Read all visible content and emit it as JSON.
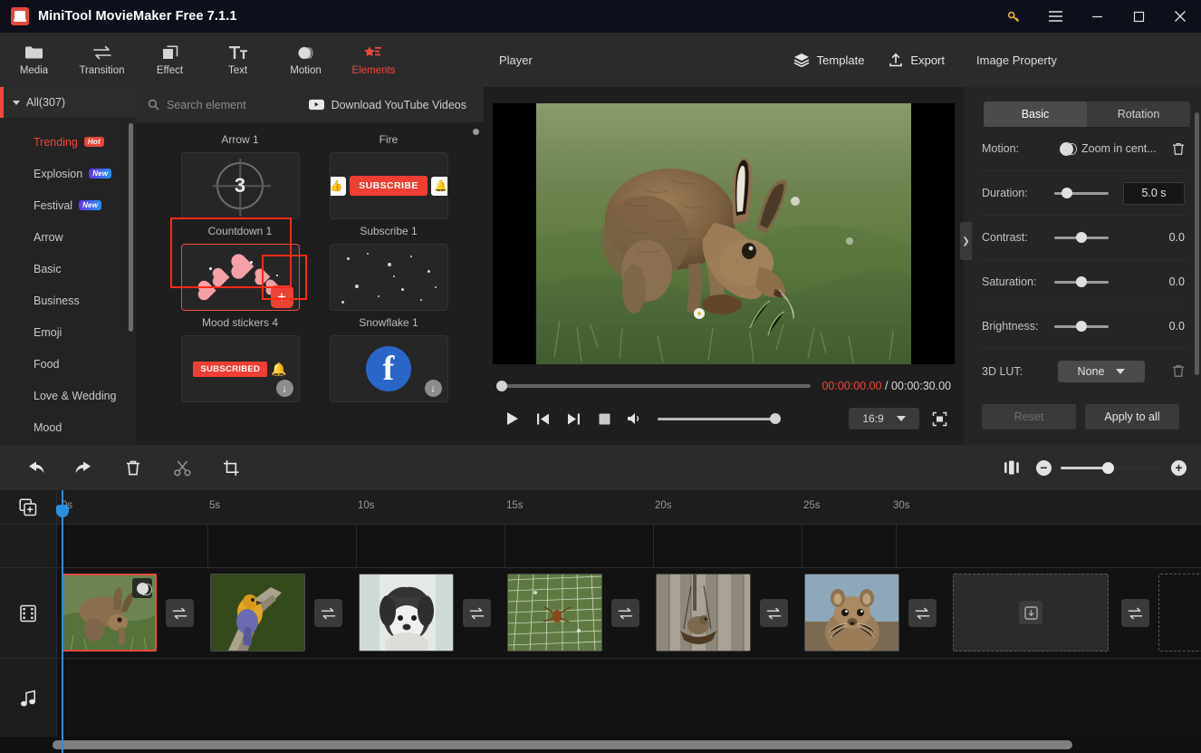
{
  "titlebar": {
    "app_name": "MiniTool MovieMaker Free 7.1.1",
    "logo_icon": "app-logo-icon",
    "key_icon": "key-icon",
    "menu_icon": "hamburger-menu-icon",
    "minimize_icon": "minimize-icon",
    "maximize_icon": "maximize-icon",
    "close_icon": "close-icon"
  },
  "toolbar": {
    "items": [
      {
        "label": "Media",
        "icon": "folder-icon",
        "active": false
      },
      {
        "label": "Transition",
        "icon": "transition-arrows-icon",
        "active": false
      },
      {
        "label": "Effect",
        "icon": "layers-square-icon",
        "active": false
      },
      {
        "label": "Text",
        "icon": "text-tt-icon",
        "active": false
      },
      {
        "label": "Motion",
        "icon": "motion-circle-icon",
        "active": false
      },
      {
        "label": "Elements",
        "icon": "elements-star-icon",
        "active": true
      }
    ],
    "active_color": "#f0483c"
  },
  "categories": {
    "all_label": "All(307)",
    "items": [
      {
        "label": "Trending",
        "badge": "Hot",
        "badge_type": "hot",
        "highlighted": true
      },
      {
        "label": "Explosion",
        "badge": "New",
        "badge_type": "new",
        "highlighted": false
      },
      {
        "label": "Festival",
        "badge": "New",
        "badge_type": "new",
        "highlighted": false
      },
      {
        "label": "Arrow",
        "badge": "",
        "badge_type": "",
        "highlighted": false
      },
      {
        "label": "Basic",
        "badge": "",
        "badge_type": "",
        "highlighted": false
      },
      {
        "label": "Business",
        "badge": "",
        "badge_type": "",
        "highlighted": false
      },
      {
        "label": "Emoji",
        "badge": "",
        "badge_type": "",
        "highlighted": false
      },
      {
        "label": "Food",
        "badge": "",
        "badge_type": "",
        "highlighted": false
      },
      {
        "label": "Love & Wedding",
        "badge": "",
        "badge_type": "",
        "highlighted": false
      },
      {
        "label": "Mood",
        "badge": "",
        "badge_type": "",
        "highlighted": false
      }
    ]
  },
  "elements_panel": {
    "search_placeholder": "Search element",
    "search_value": "",
    "search_icon": "search-icon",
    "download_label": "Download YouTube Videos",
    "download_icon": "youtube-download-icon",
    "row0": [
      {
        "caption": "Arrow 1"
      },
      {
        "caption": "Fire"
      }
    ],
    "row1": [
      {
        "caption": "Countdown 1",
        "number": "3"
      },
      {
        "caption": "Subscribe 1",
        "button_text": "SUBSCRIBE"
      }
    ],
    "row2": [
      {
        "caption": "Mood stickers 4",
        "selected": true,
        "add_icon": "plus-icon"
      },
      {
        "caption": "Snowflake 1",
        "selected": false
      }
    ],
    "row3": [
      {
        "caption": "",
        "button_text": "SUBSCRIBED",
        "download_icon": "download-icon"
      },
      {
        "caption": "",
        "logo": "f",
        "download_icon": "download-icon"
      }
    ]
  },
  "player": {
    "title": "Player",
    "template_label": "Template",
    "template_icon": "layers-icon",
    "export_label": "Export",
    "export_icon": "export-upload-icon",
    "current_time": "00:00:00.00",
    "separator": "/",
    "total_time": "00:00:30.00",
    "play_icon": "play-icon",
    "prev_icon": "previous-frame-icon",
    "next_icon": "next-frame-icon",
    "stop_icon": "stop-icon",
    "volume_icon": "volume-icon",
    "aspect_ratio": "16:9",
    "fullscreen_icon": "fullscreen-icon"
  },
  "property_panel": {
    "title": "Image Property",
    "tabs": [
      {
        "label": "Basic",
        "active": true
      },
      {
        "label": "Rotation",
        "active": false
      }
    ],
    "motion": {
      "label": "Motion:",
      "value": "Zoom in cent...",
      "delete_icon": "trash-icon"
    },
    "duration": {
      "label": "Duration:",
      "value": "5.0 s",
      "slider_pct": 22
    },
    "contrast": {
      "label": "Contrast:",
      "value": "0.0",
      "slider_pct": 50
    },
    "saturation": {
      "label": "Saturation:",
      "value": "0.0",
      "slider_pct": 50
    },
    "brightness": {
      "label": "Brightness:",
      "value": "0.0",
      "slider_pct": 50
    },
    "lut": {
      "label": "3D LUT:",
      "value": "None",
      "delete_icon": "trash-icon"
    },
    "reset_label": "Reset",
    "apply_all_label": "Apply to all",
    "collapse_icon": "chevron-right-icon"
  },
  "timeline_toolbar": {
    "buttons": [
      {
        "name": "undo",
        "icon": "undo-arrow-icon",
        "enabled": true
      },
      {
        "name": "redo",
        "icon": "redo-arrow-icon",
        "enabled": true
      },
      {
        "name": "delete",
        "icon": "trash-icon",
        "enabled": true
      },
      {
        "name": "split",
        "icon": "scissors-icon",
        "enabled": false
      },
      {
        "name": "crop",
        "icon": "crop-icon",
        "enabled": true
      }
    ],
    "fit_icon": "fit-timeline-icon",
    "zoom_out_icon": "zoom-out-icon",
    "zoom_in_icon": "zoom-in-icon",
    "zoom_pct": 45
  },
  "timeline": {
    "add_media_icon": "add-media-icon",
    "video_track_icon": "film-strip-icon",
    "audio_track_icon": "music-note-icon",
    "ruler_ticks": [
      "0s",
      "5s",
      "10s",
      "15s",
      "20s",
      "25s",
      "30s"
    ],
    "playhead_time": "0s",
    "clips": [
      {
        "name": "hare-clip",
        "selected": true,
        "motion_badge": true
      },
      {
        "name": "bird-clip",
        "selected": false,
        "motion_badge": false
      },
      {
        "name": "dog-clip",
        "selected": false,
        "motion_badge": false
      },
      {
        "name": "spider-web-clip",
        "selected": false,
        "motion_badge": false
      },
      {
        "name": "bird-feeder-clip",
        "selected": false,
        "motion_badge": false
      },
      {
        "name": "squirrel-clip",
        "selected": false,
        "motion_badge": false
      }
    ],
    "transition_icon": "transition-arrows-icon",
    "drop_zone_icon": "download-into-icon"
  },
  "colors": {
    "accent": "#f0483c",
    "playhead": "#2b8fe0",
    "titlebar_bg": "#0d0f1a",
    "panel_bg": "#2b2b2b"
  }
}
